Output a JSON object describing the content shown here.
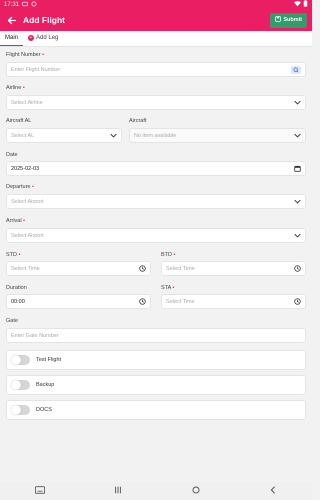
{
  "status_bar": {
    "time": "17:31"
  },
  "appbar": {
    "title": "Add Flight",
    "submit_label": "Submit"
  },
  "tabs": [
    {
      "label": "Main"
    },
    {
      "label": "Add Leg"
    }
  ],
  "form": {
    "flight_number": {
      "label": "Flight Number",
      "placeholder": "Enter Flight Number"
    },
    "airline": {
      "label": "Airline",
      "placeholder": "Select Airline"
    },
    "aircraft_al": {
      "label": "Aircraft AL",
      "placeholder": "Select AL"
    },
    "aircraft": {
      "label": "Aircraft",
      "placeholder": "No item available"
    },
    "date": {
      "label": "Date",
      "value": "2025-02-03"
    },
    "departure": {
      "label": "Departure",
      "placeholder": "Select Airport"
    },
    "arrival": {
      "label": "Arrival",
      "placeholder": "Select Airport"
    },
    "std": {
      "label": "STD",
      "placeholder": "Select Time"
    },
    "btd": {
      "label": "BTD",
      "placeholder": "Select Time"
    },
    "duration": {
      "label": "Duration",
      "value": "00:00"
    },
    "sta": {
      "label": "STA",
      "placeholder": "Select Time"
    },
    "gate": {
      "label": "Gate",
      "placeholder": "Enter Gate Number"
    },
    "toggles": [
      {
        "label": "Test Flight"
      },
      {
        "label": "Backup"
      },
      {
        "label": "DOCS"
      }
    ]
  },
  "colors": {
    "primary": "#e91e63",
    "submit": "#2e9e6b",
    "background": "#f2f2f2"
  }
}
